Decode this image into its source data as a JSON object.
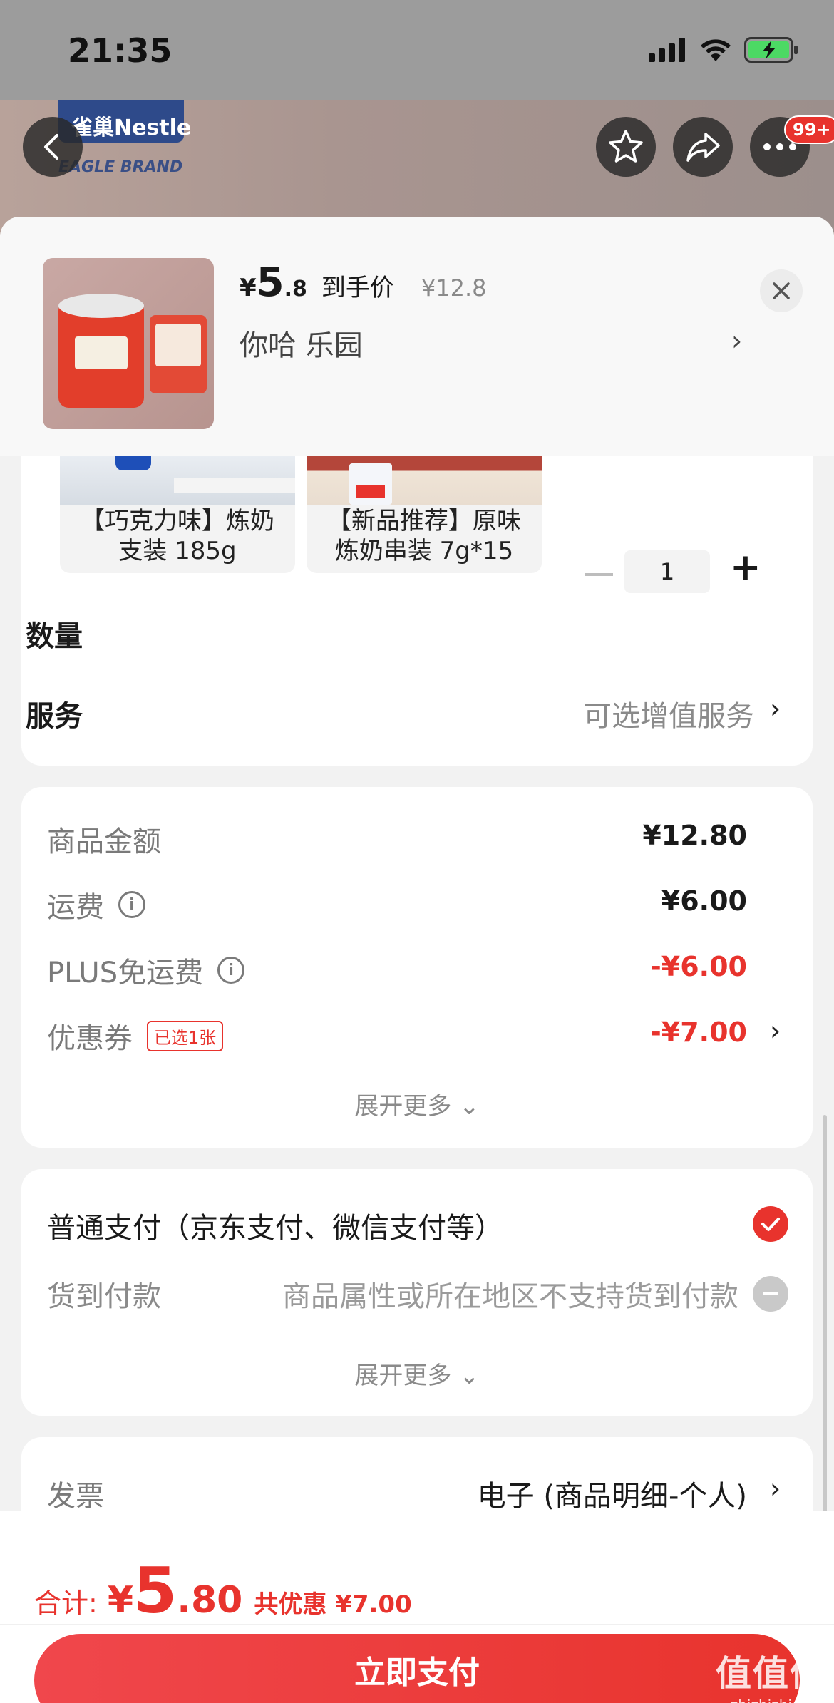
{
  "status_bar": {
    "time": "21:35"
  },
  "background": {
    "brand": "雀巢Nestle",
    "brand_sub": "EAGLE BRAND"
  },
  "top_nav": {
    "more_badge": "99+"
  },
  "product_header": {
    "yen": "¥",
    "price_int": "5",
    "price_dec": ".8",
    "price_tag": "到手价",
    "orig_price": "¥12.8",
    "store": "你哈  乐园",
    "chevron": "›"
  },
  "variants": [
    {
      "line1": "【巧克力味】炼奶",
      "line2": "支装 185g"
    },
    {
      "line1": "【新品推荐】原味",
      "line2": "炼奶串装 7g*15"
    }
  ],
  "quantity": {
    "label": "数量",
    "value": "1",
    "plus": "+"
  },
  "service": {
    "label": "服务",
    "value": "可选增值服务",
    "chevron": "›"
  },
  "amounts": {
    "goods": {
      "label": "商品金额",
      "value": "¥12.80"
    },
    "shipping": {
      "label": "运费",
      "value": "¥6.00",
      "info": "i"
    },
    "plus_free": {
      "label": "PLUS免运费",
      "value": "-¥6.00",
      "info": "i"
    },
    "coupon": {
      "label": "优惠券",
      "tag": "已选1张",
      "value": "-¥7.00",
      "chevron": "›"
    },
    "expand": "展开更多 ⌄"
  },
  "payment": {
    "normal": "普通支付（京东支付、微信支付等）",
    "cod_label": "货到付款",
    "cod_note": "商品属性或所在地区不支持货到付款",
    "expand": "展开更多 ⌄"
  },
  "invoice": {
    "label": "发票",
    "value": "电子 (商品明细-个人)",
    "chevron": "›"
  },
  "bottom_bar": {
    "total_label": "合计:",
    "yen": "¥",
    "total_int": "5",
    "total_dec": ".80",
    "savings": "共优惠 ¥7.00",
    "pay_button": "立即支付"
  },
  "watermark": {
    "big": "值值值",
    "small": "zhizhizhi.com"
  },
  "colors": {
    "accent": "#e8332d",
    "muted": "#8a8a8a"
  }
}
